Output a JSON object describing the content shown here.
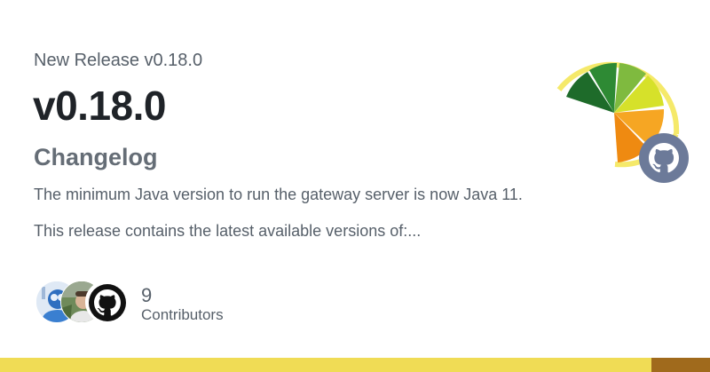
{
  "card": {
    "subtitle": "New Release v0.18.0",
    "title": "v0.18.0",
    "heading": "Changelog",
    "paragraphs": [
      "The minimum Java version to run the gateway server is now Java 11.",
      "This release contains the latest available versions of:..."
    ]
  },
  "contributors": {
    "count": "9",
    "label": "Contributors",
    "avatars": [
      "avatar-photo-1",
      "avatar-photo-2",
      "github-icon"
    ]
  },
  "logo": {
    "icon": "lemon-slice-logo",
    "badge_icon": "github-icon"
  },
  "colors": {
    "bar_main": "#f0dc55",
    "bar_end": "#a06a1c",
    "text_dark": "#1f2328",
    "text_muted": "#57606a",
    "github_badge": "#6c7a99"
  }
}
